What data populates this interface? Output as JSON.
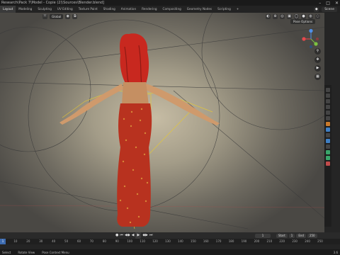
{
  "window": {
    "title": "Research\\Pack 7\\Model - Copie (2)\\Sources\\Blender.blend]",
    "minimize_icon": "minimize-icon",
    "maximize_icon": "maximize-icon",
    "close_icon": "close-icon"
  },
  "workspaces": [
    {
      "label": "Layout",
      "active": true
    },
    {
      "label": "Modeling",
      "active": false
    },
    {
      "label": "Sculpting",
      "active": false
    },
    {
      "label": "UV Editing",
      "active": false
    },
    {
      "label": "Texture Paint",
      "active": false
    },
    {
      "label": "Shading",
      "active": false
    },
    {
      "label": "Animation",
      "active": false
    },
    {
      "label": "Rendering",
      "active": false
    },
    {
      "label": "Compositing",
      "active": false
    },
    {
      "label": "Geometry Nodes",
      "active": false
    },
    {
      "label": "Scripting",
      "active": false
    },
    {
      "label": "+",
      "active": false
    }
  ],
  "scene": {
    "label": "Scene",
    "icon": "scene-icon"
  },
  "viewport": {
    "orientation": "Global",
    "pose_options": "Pose Options",
    "accent_x": "#e5484d",
    "accent_y": "#7cc241",
    "accent_z": "#4f8fe8"
  },
  "timeline": {
    "current_frame": "1",
    "start_label": "Start",
    "start_value": "1",
    "end_label": "End",
    "end_value": "250",
    "ruler_ticks": [
      "0",
      "10",
      "20",
      "30",
      "40",
      "50",
      "60",
      "70",
      "80",
      "90",
      "100",
      "110",
      "120",
      "130",
      "140",
      "150",
      "160",
      "170",
      "180",
      "190",
      "200",
      "210",
      "220",
      "230",
      "240",
      "250"
    ]
  },
  "status": {
    "select": "Select",
    "rotate": "Rotate View",
    "menu": "Pose Context Menu",
    "version": "3.6"
  }
}
